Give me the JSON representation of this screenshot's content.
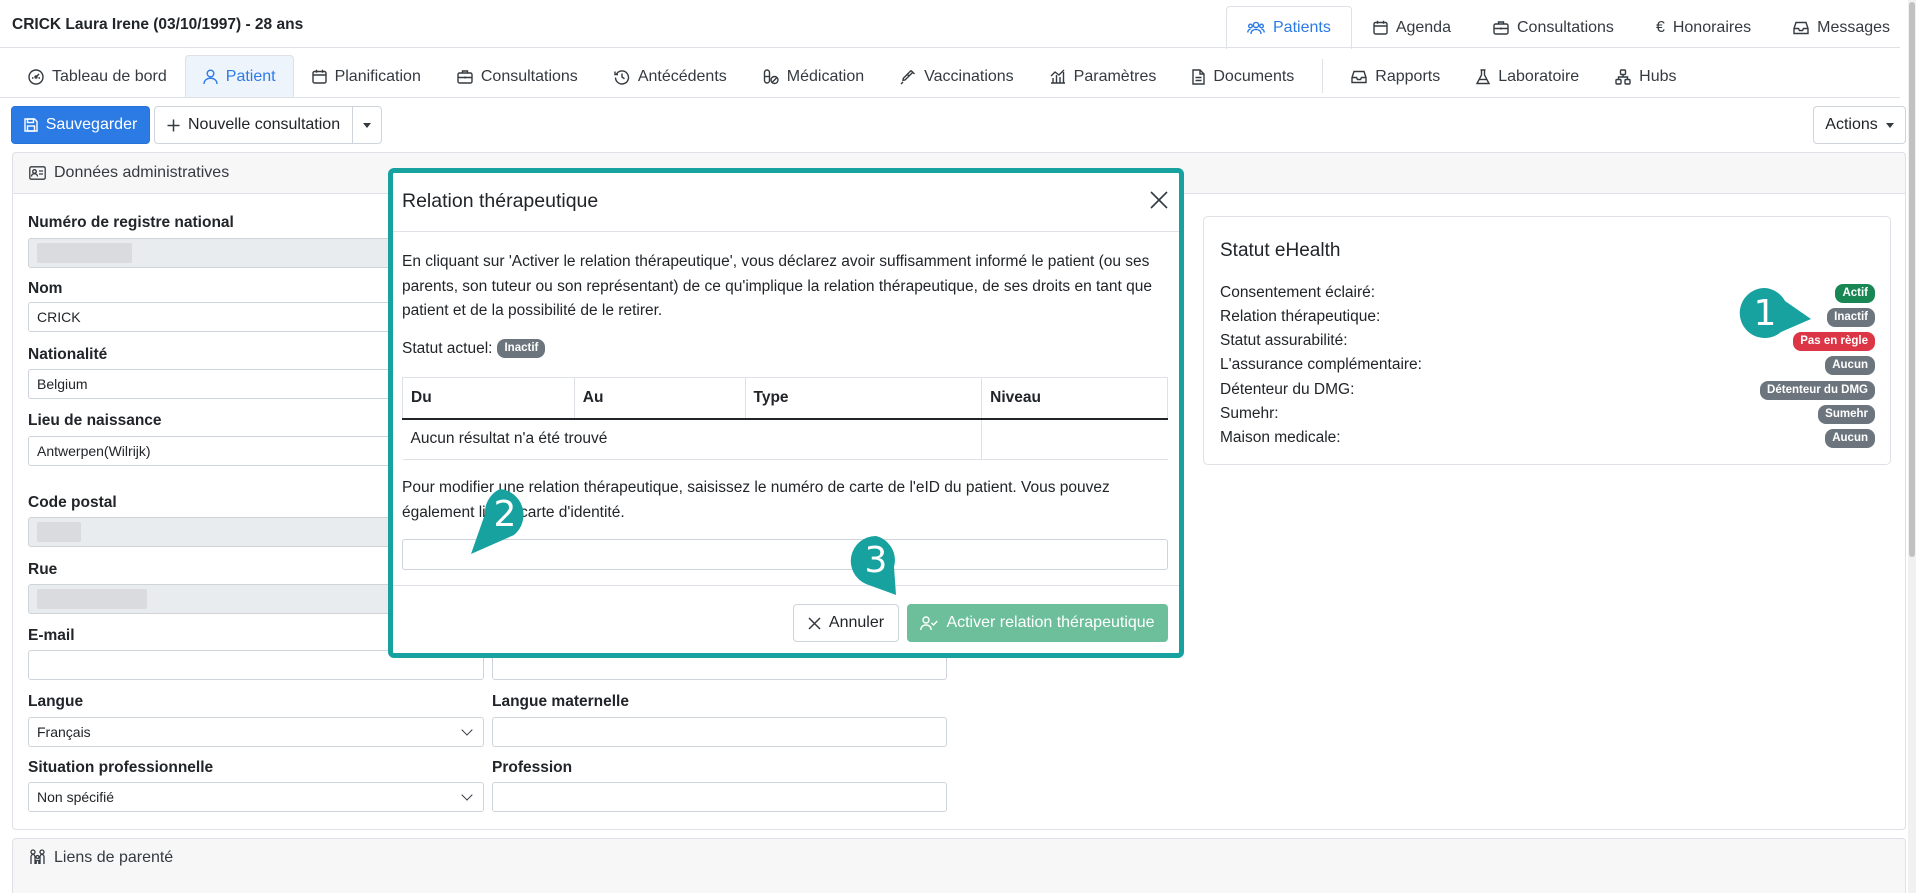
{
  "patient": {
    "title": "CRICK Laura Irene (03/10/1997) - 28 ans"
  },
  "top_nav": [
    {
      "label": "Patients",
      "icon": "users-icon",
      "active": true
    },
    {
      "label": "Agenda",
      "icon": "calendar-icon"
    },
    {
      "label": "Consultations",
      "icon": "briefcase-icon"
    },
    {
      "label": "Honoraires",
      "icon": "euro-icon"
    },
    {
      "label": "Messages",
      "icon": "inbox-icon"
    }
  ],
  "sub_nav": [
    {
      "label": "Tableau de bord",
      "icon": "dashboard-icon"
    },
    {
      "label": "Patient",
      "icon": "user-icon",
      "active": true
    },
    {
      "label": "Planification",
      "icon": "calendar-icon"
    },
    {
      "label": "Consultations",
      "icon": "briefcase-icon"
    },
    {
      "label": "Antécédents",
      "icon": "history-icon"
    },
    {
      "label": "Médication",
      "icon": "pills-icon"
    },
    {
      "label": "Vaccinations",
      "icon": "syringe-icon"
    },
    {
      "label": "Paramètres",
      "icon": "chart-icon"
    },
    {
      "label": "Documents",
      "icon": "document-icon"
    },
    {
      "label": "Rapports",
      "icon": "inbox-icon"
    },
    {
      "label": "Laboratoire",
      "icon": "flask-icon"
    },
    {
      "label": "Hubs",
      "icon": "hubs-icon"
    }
  ],
  "toolbar": {
    "save": "Sauvegarder",
    "new_consultation": "Nouvelle consultation",
    "actions": "Actions"
  },
  "admin": {
    "header": "Données administratives",
    "labels": {
      "niss": "Numéro de registre national",
      "nom": "Nom",
      "nationalite": "Nationalité",
      "lieu": "Lieu de naissance",
      "code_postal": "Code postal",
      "rue": "Rue",
      "email": "E-mail",
      "langue": "Langue",
      "langue_maternelle": "Langue maternelle",
      "situation": "Situation professionnelle",
      "profession": "Profession"
    },
    "values": {
      "nom": "CRICK",
      "nationalite": "Belgium",
      "lieu": "Antwerpen(Wilrijk)",
      "langue": "Français",
      "situation": "Non spécifié"
    }
  },
  "ehealth": {
    "title": "Statut eHealth",
    "rows": [
      {
        "label": "Consentement éclairé:",
        "badge": "Actif",
        "color": "#198754"
      },
      {
        "label": "Relation thérapeutique:",
        "badge": "Inactif",
        "color": "#6c757d"
      },
      {
        "label": "Statut assurabilité:",
        "badge": "Pas en règle",
        "color": "#dc3545"
      },
      {
        "label": "L'assurance complémentaire:",
        "badge": "Aucun",
        "color": "#6c757d"
      },
      {
        "label": "Détenteur du DMG:",
        "badge": "Détenteur du DMG",
        "color": "#6c757d"
      },
      {
        "label": "Sumehr:",
        "badge": "Sumehr",
        "color": "#6c757d"
      },
      {
        "label": "Maison medicale:",
        "badge": "Aucun",
        "color": "#6c757d"
      }
    ]
  },
  "family": {
    "header": "Liens de parenté"
  },
  "modal": {
    "title": "Relation thérapeutique",
    "text1": "En cliquant sur 'Activer le relation thérapeutique', vous déclarez avoir suffisamment informé le patient (ou ses parents, son tuteur ou son représentant) de ce qu'implique la relation thérapeutique, de ses droits en tant que patient et de la possibilité de le retirer.",
    "status_label": "Statut actuel:",
    "status_badge": "Inactif",
    "table": {
      "headers": [
        "Du",
        "Au",
        "Type",
        "Niveau"
      ],
      "empty": "Aucun résultat n'a été trouvé"
    },
    "text2": "Pour modifier une relation thérapeutique, saisissez le numéro de carte de l'eID du patient. Vous pouvez également lire la carte d'identité.",
    "cancel": "Annuler",
    "activate": "Activer relation thérapeutique"
  },
  "callouts": [
    "1",
    "2",
    "3"
  ],
  "colors": {
    "accent": "#2c7be5",
    "callout": "#17a2a0",
    "activate": "#6cbf9a"
  }
}
